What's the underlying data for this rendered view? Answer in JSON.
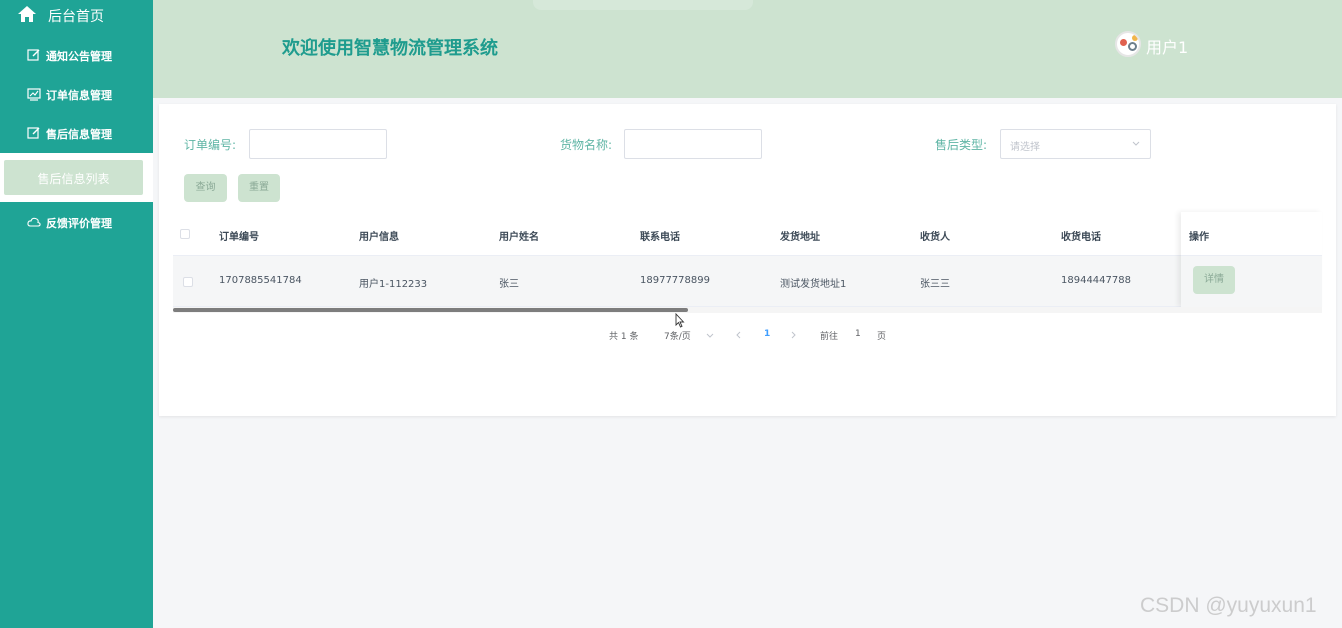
{
  "sidebar": {
    "home_label": "后台首页",
    "items": [
      {
        "label": "通知公告管理",
        "icon": "edit-icon"
      },
      {
        "label": "订单信息管理",
        "icon": "chart-icon"
      },
      {
        "label": "售后信息管理",
        "icon": "edit-icon"
      },
      {
        "label": "反馈评价管理",
        "icon": "cloud-icon"
      }
    ],
    "active_sub": "售后信息列表"
  },
  "header": {
    "title": "欢迎使用智慧物流管理系统",
    "user": "用户1"
  },
  "search": {
    "order_no_label": "订单编号:",
    "goods_name_label": "货物名称:",
    "aftersale_type_label": "售后类型:",
    "select_placeholder": "请选择",
    "query_button": "查询",
    "reset_button": "重置"
  },
  "table": {
    "columns": [
      "订单编号",
      "用户信息",
      "用户姓名",
      "联系电话",
      "发货地址",
      "收货人",
      "收货电话",
      "操作"
    ],
    "rows": [
      {
        "order_no": "1707885541784",
        "user_info": "用户1-112233",
        "user_name": "张三",
        "phone": "18977778899",
        "ship_address": "测试发货地址1",
        "receiver": "张三三",
        "receiver_phone": "18944447788",
        "action": "详情"
      }
    ]
  },
  "pagination": {
    "total": "共 1 条",
    "page_size": "7条/页",
    "current_page": "1",
    "goto_prefix": "前往",
    "goto_value": "1",
    "goto_suffix": "页"
  },
  "watermark": "CSDN @yuyuxun1",
  "colors": {
    "sidebar": "#1fa496",
    "header": "#cde3d0",
    "title": "#1f9c8e",
    "accent_button": "#cde3d0",
    "label": "#5fb5a5",
    "active_page": "#409eff"
  }
}
